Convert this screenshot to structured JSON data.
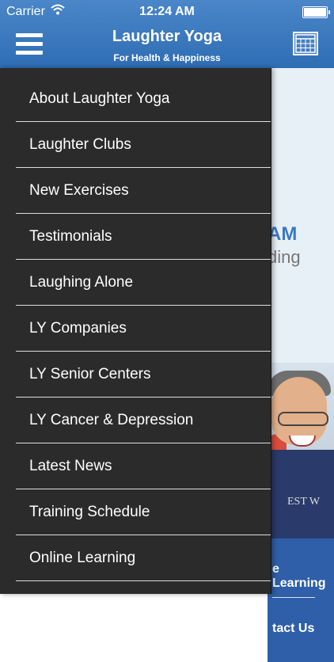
{
  "status_bar": {
    "carrier": "Carrier",
    "time": "12:24 AM"
  },
  "header": {
    "title": "Laughter Yoga",
    "subtitle": "For Health & Happiness",
    "menu_icon": "hamburger-menu-icon",
    "right_icon": "calendar-grid-icon",
    "colors": {
      "header_top": "#4a86c8",
      "header_bottom": "#2f6db4"
    }
  },
  "background": {
    "partial_logo": "AM",
    "partial_sub": "ding",
    "shirt_text": "EST W",
    "footer_link_1": "e Learning",
    "footer_link_2": "tact Us"
  },
  "drawer": {
    "items": [
      {
        "label": "About Laughter Yoga"
      },
      {
        "label": "Laughter Clubs"
      },
      {
        "label": "New Exercises"
      },
      {
        "label": "Testimonials"
      },
      {
        "label": "Laughing Alone"
      },
      {
        "label": "LY Companies"
      },
      {
        "label": "LY Senior Centers"
      },
      {
        "label": "LY Cancer & Depression"
      },
      {
        "label": "Latest News"
      },
      {
        "label": "Training Schedule"
      },
      {
        "label": "Online Learning"
      }
    ],
    "colors": {
      "background": "#2b2b2b",
      "divider": "#f2f2f2",
      "text": "#ffffff"
    }
  }
}
